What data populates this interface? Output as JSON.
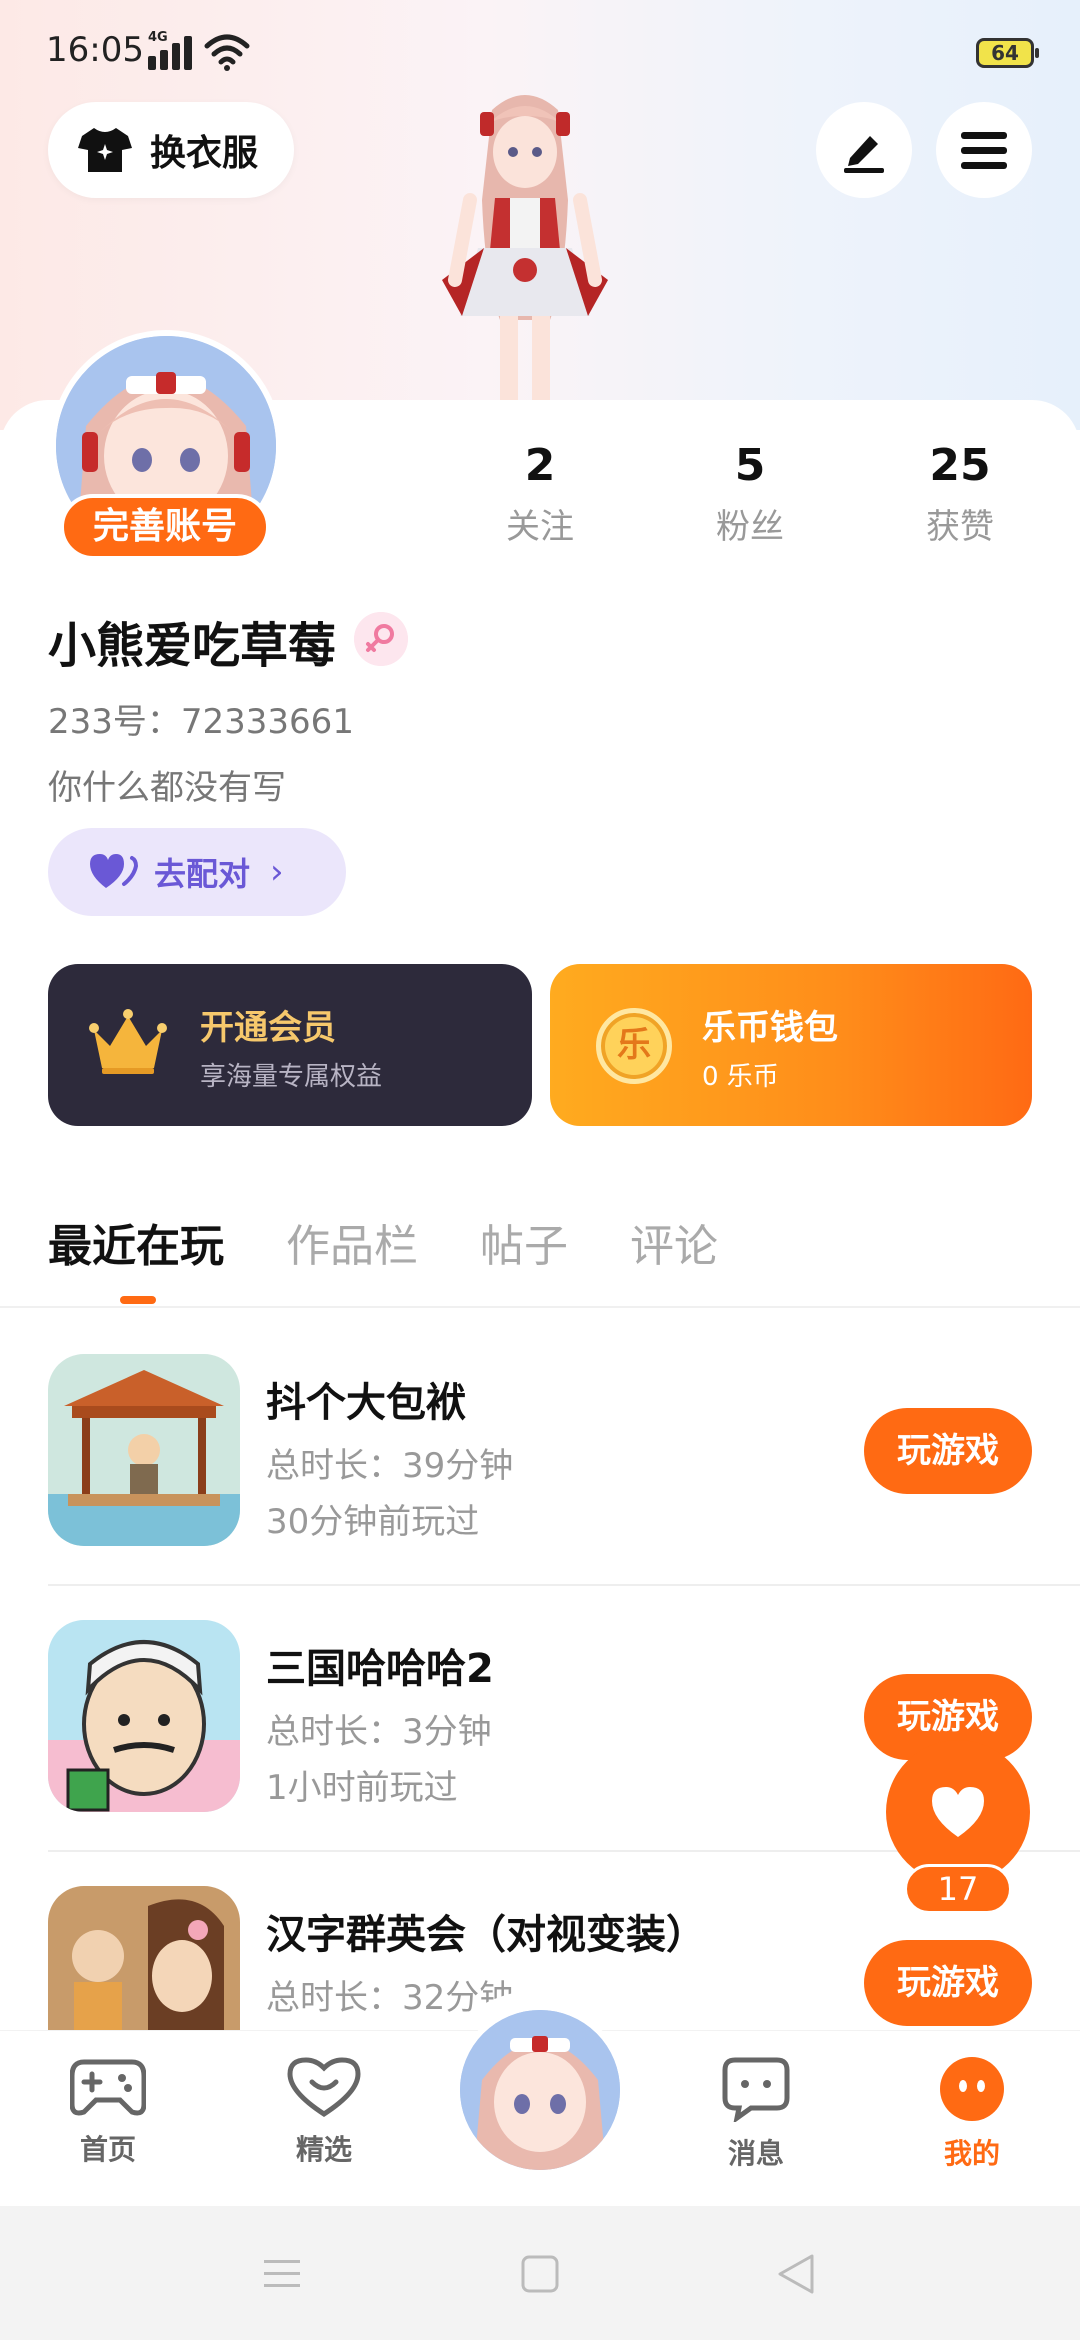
{
  "status_bar": {
    "time": "16:05",
    "network": "4G",
    "battery": "64"
  },
  "header": {
    "outfit_label": "换衣服"
  },
  "profile": {
    "complete_badge": "完善账号",
    "stats": [
      {
        "value": "2",
        "label": "关注"
      },
      {
        "value": "5",
        "label": "粉丝"
      },
      {
        "value": "25",
        "label": "获赞"
      }
    ],
    "nickname": "小熊爱吃草莓",
    "uid": "233号：72333661",
    "bio": "你什么都没有写",
    "match_label": "去配对"
  },
  "promo": {
    "vip": {
      "title": "开通会员",
      "subtitle": "享海量专属权益"
    },
    "wallet": {
      "title": "乐币钱包",
      "subtitle": "0 乐币",
      "coin_glyph": "乐"
    }
  },
  "tabs": [
    "最近在玩",
    "作品栏",
    "帖子",
    "评论"
  ],
  "games": [
    {
      "title": "抖个大包袱",
      "duration": "总时长：39分钟",
      "last_played": "30分钟前玩过",
      "play_label": "玩游戏"
    },
    {
      "title": "三国哈哈哈2",
      "duration": "总时长：3分钟",
      "last_played": "1小时前玩过",
      "play_label": "玩游戏"
    },
    {
      "title": "汉字群英会（对视变装）",
      "duration": "总时长：32分钟",
      "last_played": "",
      "play_label": "玩游戏"
    }
  ],
  "like_count": "17",
  "bottom_nav": [
    {
      "label": "首页",
      "icon": "gamepad-icon"
    },
    {
      "label": "精选",
      "icon": "heart-chat-icon"
    },
    {
      "label": "消息",
      "icon": "message-icon"
    },
    {
      "label": "我的",
      "icon": "profile-face-icon"
    }
  ],
  "colors": {
    "accent": "#ff6a13",
    "vip_bg": "#2d2a3b",
    "vip_gold": "#f6c86c",
    "match_purple": "#6a58d6"
  }
}
